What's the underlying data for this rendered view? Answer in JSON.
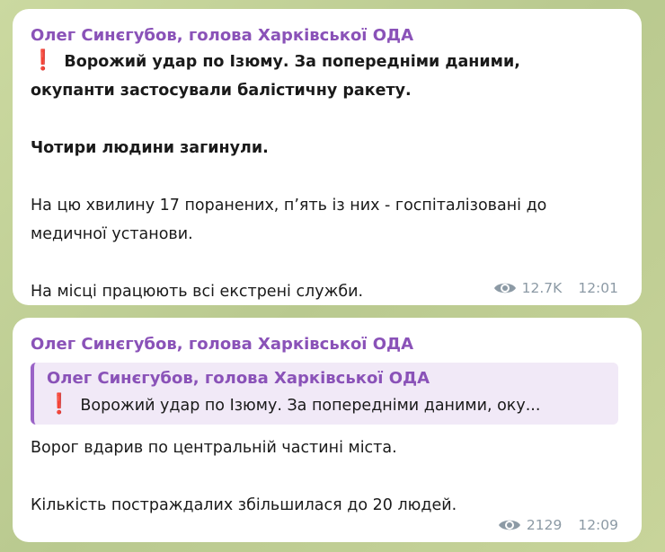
{
  "messages": [
    {
      "sender": "Олег Синєгубов, голова Харківської ОДА",
      "exclamation": "❗",
      "line1": "Ворожий удар по Ізюму. За попередніми даними,",
      "line2": "окупанти застосували балістичну ракету.",
      "bold_line": "Чотири людини загинули.",
      "line3": "На цю хвилину 17 поранених, п’ять із них - госпіталізовані до",
      "line4": "медичної установи.",
      "line5": "На місці працюють всі екстрені служби.",
      "views": "12.7K",
      "time": "12:01",
      "views_icon": "eye-icon"
    },
    {
      "sender": "Олег Синєгубов, голова Харківської ОДА",
      "reply": {
        "sender": "Олег Синєгубов, голова Харківської ОДА",
        "exclamation": "❗",
        "text": "Ворожий удар по Ізюму. За попередніми даними, оку..."
      },
      "line1": "Ворог вдарив по центральній частині міста.",
      "line2": "Кількість постраждалих збільшилася до 20 людей.",
      "views": "2129",
      "time": "12:09",
      "views_icon": "eye-icon"
    }
  ],
  "colors": {
    "sender": "#8a52b8",
    "exclamation": "#d62424",
    "meta": "#8c9aa5",
    "bubble": "#ffffff",
    "quote_bg": "#f1e9f7",
    "quote_bar": "#9a63c7"
  }
}
